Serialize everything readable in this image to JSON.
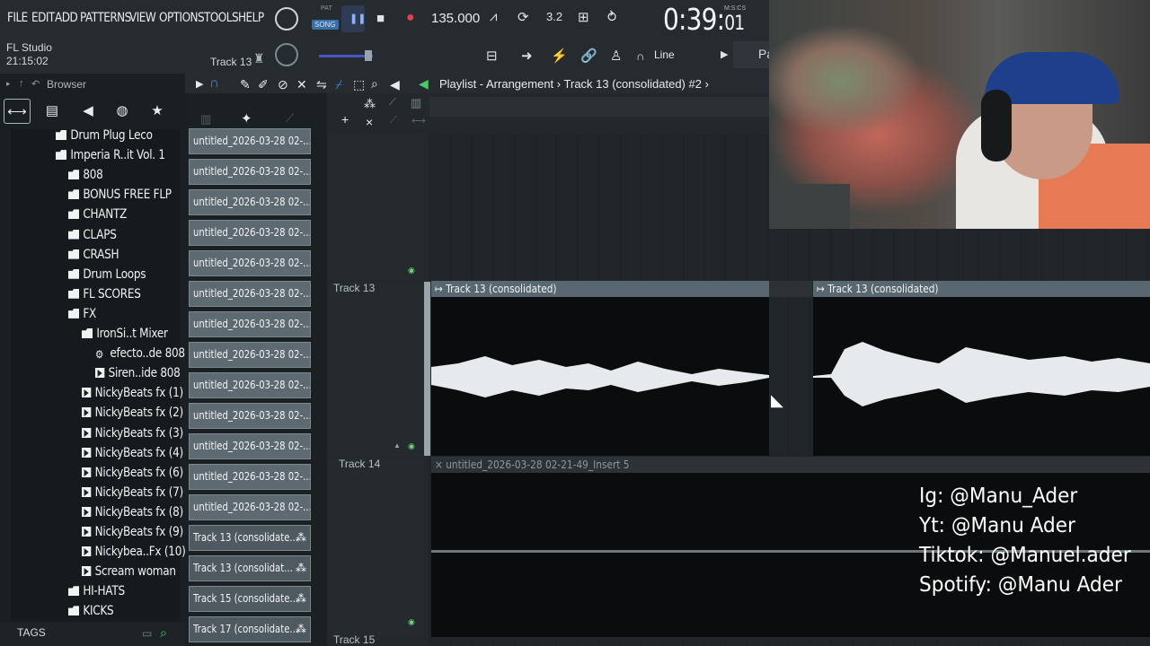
{
  "menu": [
    "FILE",
    "EDIT",
    "ADD",
    "PATTERNS",
    "VIEW",
    "OPTIONS",
    "TOOLS",
    "HELP"
  ],
  "transport": {
    "pat_label": "PAT",
    "song_label": "SONG",
    "bpm": "135.000",
    "time_main": "0:39:",
    "time_sub": "01",
    "time_units": "M:S:CS"
  },
  "header": {
    "app_name": "FL Studio",
    "app_time": "21:15:02",
    "track_label": "Track 13",
    "snap_mode": "Line",
    "pattern_partial": "Pa"
  },
  "browser": {
    "title": "Browser",
    "tags_label": "TAGS",
    "tree": [
      {
        "label": "Drum Plug Leco",
        "type": "folder",
        "depth": 0
      },
      {
        "label": "Imperia R..it Vol. 1",
        "type": "folder",
        "depth": 0
      },
      {
        "label": "808",
        "type": "folder",
        "depth": 1
      },
      {
        "label": "BONUS FREE FLP",
        "type": "folder",
        "depth": 1
      },
      {
        "label": "CHANTZ",
        "type": "folder",
        "depth": 1
      },
      {
        "label": "CLAPS",
        "type": "folder",
        "depth": 1
      },
      {
        "label": "CRASH",
        "type": "folder",
        "depth": 1
      },
      {
        "label": "Drum Loops",
        "type": "folder",
        "depth": 1
      },
      {
        "label": "FL SCORES",
        "type": "folder",
        "depth": 1
      },
      {
        "label": "FX",
        "type": "folder",
        "depth": 1
      },
      {
        "label": "IronSi..t Mixer",
        "type": "folder",
        "depth": 2
      },
      {
        "label": "efecto..de 808",
        "type": "gear",
        "depth": 3
      },
      {
        "label": "Siren..ide 808",
        "type": "play",
        "depth": 3
      },
      {
        "label": "NickyBeats fx (1)",
        "type": "play",
        "depth": 2
      },
      {
        "label": "NickyBeats fx (2)",
        "type": "play",
        "depth": 2
      },
      {
        "label": "NickyBeats fx (3)",
        "type": "play",
        "depth": 2
      },
      {
        "label": "NickyBeats fx (4)",
        "type": "play",
        "depth": 2
      },
      {
        "label": "NickyBeats fx (6)",
        "type": "play",
        "depth": 2
      },
      {
        "label": "NickyBeats fx (7)",
        "type": "play",
        "depth": 2
      },
      {
        "label": "NickyBeats fx (8)",
        "type": "play",
        "depth": 2
      },
      {
        "label": "NickyBeats fx (9)",
        "type": "play",
        "depth": 2
      },
      {
        "label": "Nickybea..Fx (10)",
        "type": "play",
        "depth": 2
      },
      {
        "label": "Scream woman",
        "type": "play",
        "depth": 2
      },
      {
        "label": "HI-HATS",
        "type": "folder",
        "depth": 1
      },
      {
        "label": "KICKS",
        "type": "folder",
        "depth": 1
      }
    ]
  },
  "picker": {
    "items": [
      {
        "label": "untitled_2026-03-28 02-...",
        "audio": false
      },
      {
        "label": "untitled_2026-03-28 02-...",
        "audio": false
      },
      {
        "label": "untitled_2026-03-28 02-...",
        "audio": false
      },
      {
        "label": "untitled_2026-03-28 02-...",
        "audio": false
      },
      {
        "label": "untitled_2026-03-28 02-...",
        "audio": false
      },
      {
        "label": "untitled_2026-03-28 02-...",
        "audio": false
      },
      {
        "label": "untitled_2026-03-28 02-...",
        "audio": false
      },
      {
        "label": "untitled_2026-03-28 02-...",
        "audio": false
      },
      {
        "label": "untitled_2026-03-28 02-...",
        "audio": false
      },
      {
        "label": "untitled_2026-03-28 02-...",
        "audio": false
      },
      {
        "label": "untitled_2026-03-28 02-...",
        "audio": false
      },
      {
        "label": "untitled_2026-03-28 02-...",
        "audio": false
      },
      {
        "label": "untitled_2026-03-28 02-...",
        "audio": false
      },
      {
        "label": "Track 13 (consolidate...",
        "audio": true
      },
      {
        "label": "Track 13 (consolidat...",
        "audio": true
      },
      {
        "label": "Track 15 (consolidate...",
        "audio": true
      },
      {
        "label": "Track 17 (consolidate...",
        "audio": true
      }
    ]
  },
  "playlist": {
    "title": "Playlist - Arrangement",
    "breadcrumb_sep": "›",
    "current": "Track 13 (consolidated) #2",
    "tracks": [
      {
        "name": "Track 13"
      },
      {
        "name": "Track 14"
      },
      {
        "name": "Track 15"
      }
    ],
    "clips": {
      "c1": "Track 13 (consolidated)",
      "c2": "Track 13 (consolidated)",
      "c3": "untitled_2026-03-28 02-21-49_Insert 5"
    }
  },
  "overlay": {
    "ig": "Ig: @Manu_Ader",
    "yt": "Yt: @Manu Ader",
    "tiktok": "Tiktok: @Manuel.ader",
    "spotify": "Spotify: @Manu Ader"
  }
}
